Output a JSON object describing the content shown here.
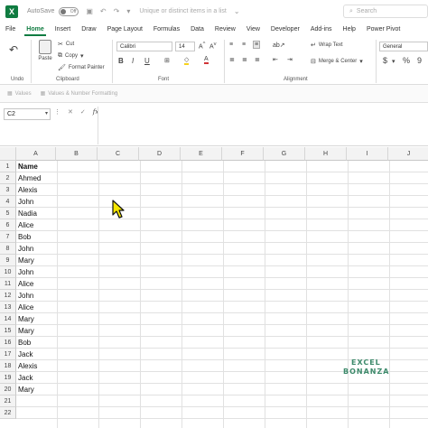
{
  "titlebar": {
    "app_logo": "X",
    "autosave_label": "AutoSave",
    "toggle_state": "Off",
    "doc_title": "Unique or distinct items in a list",
    "search_placeholder": "Search",
    "undo_icon": "undo-icon",
    "redo_icon": "redo-icon"
  },
  "menu": {
    "tabs": [
      "File",
      "Home",
      "Insert",
      "Draw",
      "Page Layout",
      "Formulas",
      "Data",
      "Review",
      "View",
      "Developer",
      "Add-ins",
      "Help",
      "Power Pivot"
    ],
    "active": "Home"
  },
  "ribbon": {
    "paste_label": "Paste",
    "cut_label": "Cut",
    "copy_label": "Copy",
    "format_painter_label": "Format Painter",
    "clipboard_label": "Clipboard",
    "undo_label": "Undo",
    "font_name": "Calibri",
    "font_size": "14",
    "font_label": "Font",
    "bold": "B",
    "italic": "I",
    "underline": "U",
    "wrap_text_label": "Wrap Text",
    "merge_center_label": "Merge & Center",
    "alignment_label": "Alignment",
    "number_format": "General",
    "currency_symbol": "$",
    "percent_symbol": "%"
  },
  "subbar": {
    "values_label": "Values",
    "values_number_formatting_label": "Values & Number Formatting"
  },
  "formula_bar": {
    "name_box": "C2",
    "fx_label": "fx",
    "cancel_glyph": "✕",
    "enter_glyph": "✓",
    "formula": ""
  },
  "grid": {
    "columns": [
      "A",
      "B",
      "C",
      "D",
      "E",
      "F",
      "G",
      "H",
      "I",
      "J"
    ],
    "rows": [
      "1",
      "2",
      "3",
      "4",
      "5",
      "6",
      "7",
      "8",
      "9",
      "10",
      "11",
      "12",
      "13",
      "14",
      "15",
      "16",
      "17",
      "18",
      "19",
      "20",
      "21",
      "22"
    ],
    "column_a": [
      "Name",
      "Ahmed",
      "Alexis",
      "John",
      "Nadia",
      "Alice",
      "Bob",
      "John",
      "Mary",
      "John",
      "Alice",
      "John",
      "Alice",
      "Mary",
      "Mary",
      "Bob",
      "Jack",
      "Alexis",
      "Jack",
      "Mary",
      "",
      ""
    ]
  },
  "watermark": {
    "line1": "EXCEL",
    "line2": "BONANZA",
    "color": "#3d8a6b"
  },
  "colors": {
    "accent": "#107c41",
    "gridline": "#e1e1e1",
    "header_bg": "#f3f3f3"
  }
}
